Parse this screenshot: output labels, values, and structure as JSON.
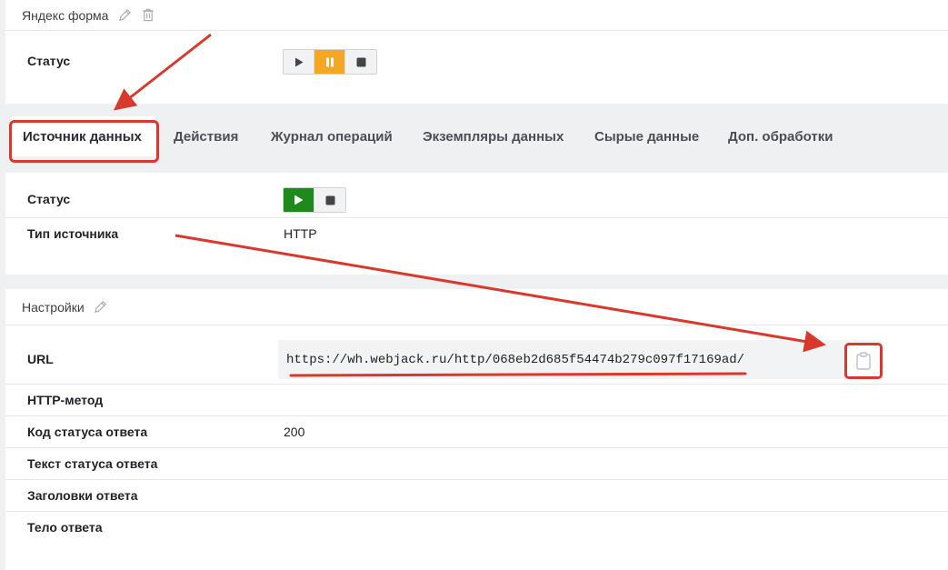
{
  "form_card": {
    "title": "Яндекс форма",
    "status_label": "Статус"
  },
  "tabs": [
    {
      "label": "Источник данных",
      "active": true
    },
    {
      "label": "Действия",
      "active": false
    },
    {
      "label": "Журнал операций",
      "active": false
    },
    {
      "label": "Экземпляры данных",
      "active": false
    },
    {
      "label": "Сырые данные",
      "active": false
    },
    {
      "label": "Доп. обработки",
      "active": false
    }
  ],
  "source_card": {
    "status_label": "Статус",
    "source_type_label": "Тип источника",
    "source_type_value": "HTTP"
  },
  "settings_card": {
    "title": "Настройки",
    "url_label": "URL",
    "url_value": "https://wh.webjack.ru/http/068eb2d685f54474b279c097f17169ad/",
    "method_label": "HTTP-метод",
    "method_value": "",
    "status_code_label": "Код статуса ответа",
    "status_code_value": "200",
    "status_text_label": "Текст статуса ответа",
    "headers_label": "Заголовки ответа",
    "body_label": "Тело ответа"
  },
  "icons": {
    "edit": "pencil-icon",
    "delete": "trash-icon",
    "play": "play-icon",
    "pause": "pause-icon",
    "stop": "stop-icon",
    "copy": "clipboard-icon"
  },
  "colors": {
    "pause_active": "#f5a623",
    "play_active": "#1e8a1e",
    "annotation": "#d9392c"
  }
}
